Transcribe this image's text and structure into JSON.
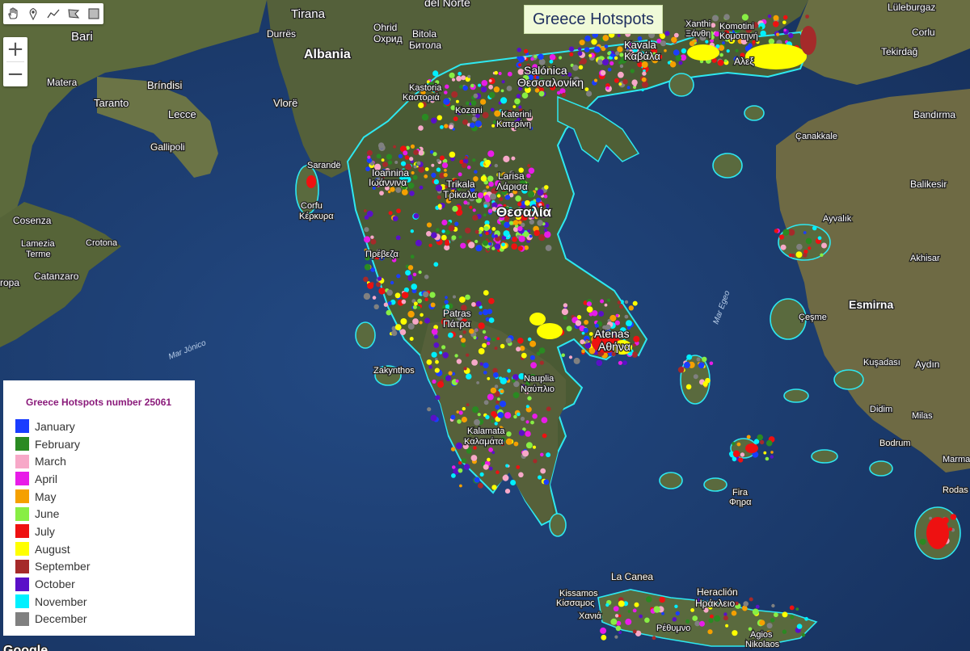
{
  "map_title": "Greece Hotspots",
  "toolbar": {
    "tools": [
      {
        "icon": "hand-icon"
      },
      {
        "icon": "marker-icon"
      },
      {
        "icon": "line-icon"
      },
      {
        "icon": "polygon-icon"
      },
      {
        "icon": "rectangle-icon"
      }
    ]
  },
  "zoom": {
    "in_label": "+",
    "out_label": "−"
  },
  "legend": {
    "title": "Greece Hotspots number 25061",
    "items": [
      {
        "label": "January",
        "color": "#1a3dff"
      },
      {
        "label": "February",
        "color": "#2a8a22"
      },
      {
        "label": "March",
        "color": "#f7a8c8"
      },
      {
        "label": "April",
        "color": "#e81ce8"
      },
      {
        "label": "May",
        "color": "#f5a000"
      },
      {
        "label": "June",
        "color": "#88ee44"
      },
      {
        "label": "July",
        "color": "#ee1111"
      },
      {
        "label": "August",
        "color": "#ffff00"
      },
      {
        "label": "September",
        "color": "#a52a2a"
      },
      {
        "label": "October",
        "color": "#5a10c8"
      },
      {
        "label": "November",
        "color": "#00f0ff"
      },
      {
        "label": "December",
        "color": "#808080"
      }
    ]
  },
  "labels": {
    "tirana": "Tirana",
    "durres": "Durrës",
    "albania": "Albania",
    "bari": "Bari",
    "ohrid": "Ohrid",
    "ohrid_cyr": "Охрид",
    "bitola": "Bitola",
    "bitola_cyr": "Битола",
    "del_norte": "del Norte",
    "matera": "Matera",
    "brindisi": "Bríndisi",
    "taranto": "Taranto",
    "lecce": "Lecce",
    "gallipoli": "Gallipoli",
    "vlore": "Vlorë",
    "sarande": "Sarandë",
    "corfu": "Corfu",
    "corfu_gr": "Κέρκυρα",
    "ioannina": "Ioannina",
    "ioannina_gr": "Ιωάννινα",
    "trikala": "Trikala",
    "trikala_gr": "Τρίκαλα",
    "larisa": "Larisa",
    "larisa_gr": "Λάρισα",
    "kastoria": "Kastoria",
    "kastoria_gr": "Καστοριά",
    "kozani": "Kozani",
    "katerini": "Katerini",
    "katerini_gr": "Κατερίνη",
    "salonica": "Salónica",
    "salonica_gr": "Θεσσαλονίκη",
    "kavala": "Kavala",
    "kavala_gr": "Καβάλα",
    "xanthi": "Xanthi",
    "xanthi_gr": "Ξάνθη",
    "komotini": "Komotini",
    "komotini_gr": "Κομοτηνή",
    "alexandroupoli_gr": "Αλεξ",
    "luleburgaz": "Lüleburgaz",
    "corlu": "Corlu",
    "tekirdag": "Tekirdağ",
    "bandirma": "Bandırma",
    "canakkale": "Çanakkale",
    "balikesir": "Balikesir",
    "ayvalik": "Ayvalık",
    "akhisar": "Akhisar",
    "esmirna": "Esmirna",
    "cesme": "Çeşme",
    "kusadasi": "Kuşadası",
    "aydin": "Aydın",
    "didim": "Didim",
    "milas": "Milas",
    "bodrum": "Bodrum",
    "marma": "Marma",
    "rodas": "Rodas",
    "cosenza": "Cosenza",
    "lamezia": "Lamezia",
    "terme": "Terme",
    "crotona": "Crotona",
    "catanzaro": "Catanzaro",
    "europa": "ropa",
    "mar_jonico": "Mar Jónico",
    "mar_egeo": "Mar Egeo",
    "preveza_gr": "Πρέβεζα",
    "patras": "Patras",
    "patras_gr": "Πάτρα",
    "zakynthos": "Zakynthos",
    "nauplia": "Nauplia",
    "nauplia_gr": "Ναύπλιο",
    "kalamata": "Kalamata",
    "kalamata_gr": "Καλαμάτα",
    "atenas": "Atenas",
    "atenas_gr": "Αθήνα",
    "tesalia": "Θεσαλία",
    "fira": "Fira",
    "fira_gr": "Φηρα",
    "kissamos": "Kissamos",
    "kissamos_gr": "Κίσσαμος",
    "la_canea": "La Canea",
    "heraclion": "Heraclión",
    "heraclion_gr": "Ηράκλειο",
    "rethymno_gr": "Ρέθυμνο",
    "agios": "Agios",
    "nikolaos": "Nikolaos",
    "chania_gr": "Χανιά",
    "google": "Google"
  }
}
